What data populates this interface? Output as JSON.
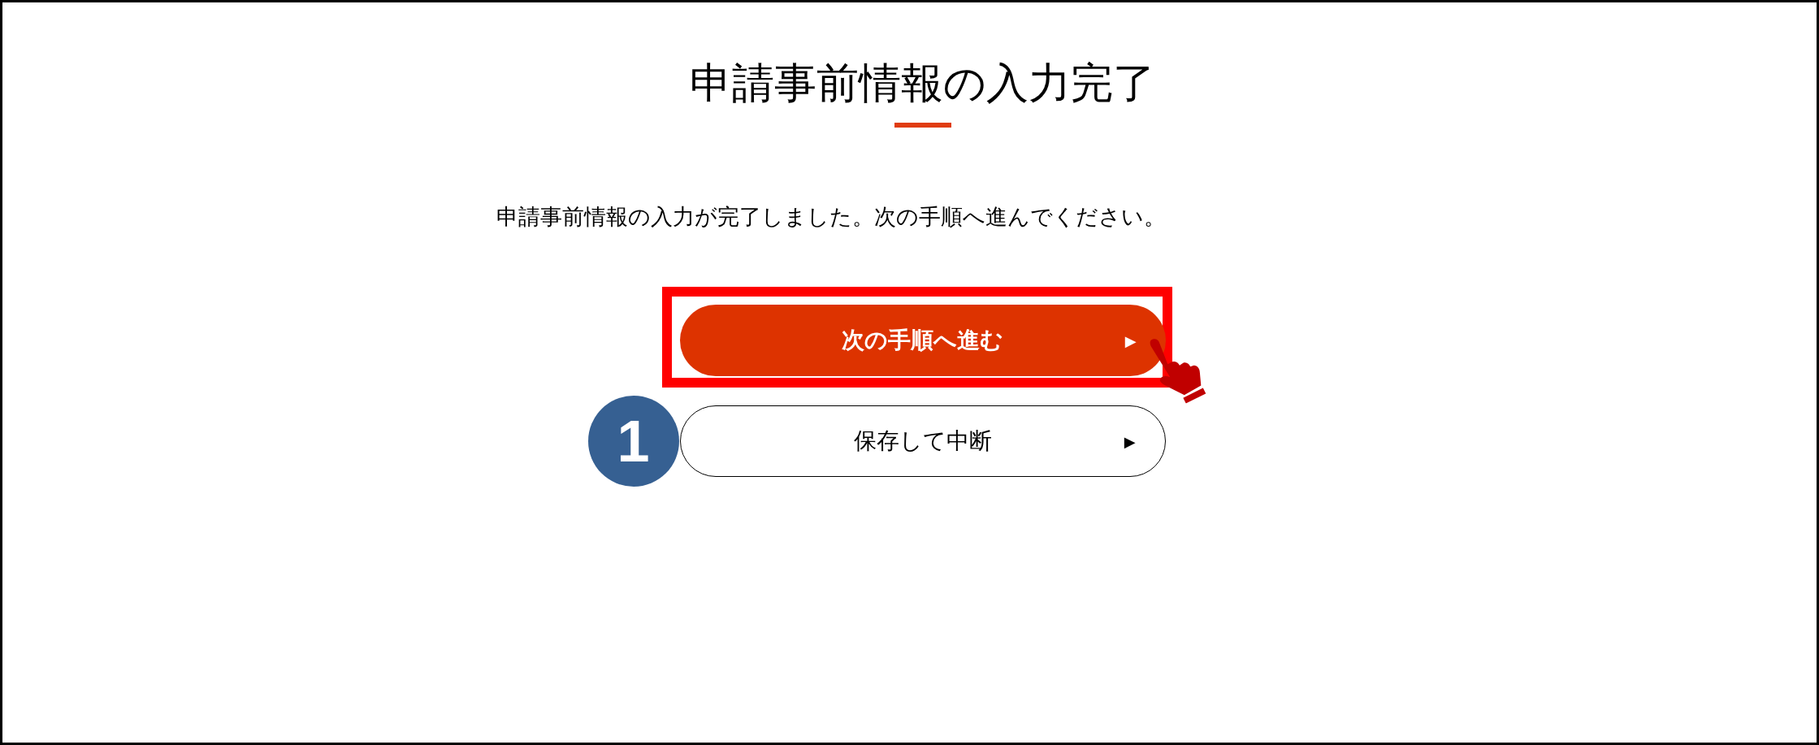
{
  "title": "申請事前情報の入力完了",
  "message": "申請事前情報の入力が完了しました。次の手順へ進んでください。",
  "buttons": [
    {
      "label": "次の手順へ進む",
      "arrow": "▶",
      "kind": "primary",
      "highlighted": true
    },
    {
      "label": "保存して中断",
      "arrow": "▶",
      "kind": "secondary",
      "highlighted": false
    }
  ],
  "step_badge": "1"
}
